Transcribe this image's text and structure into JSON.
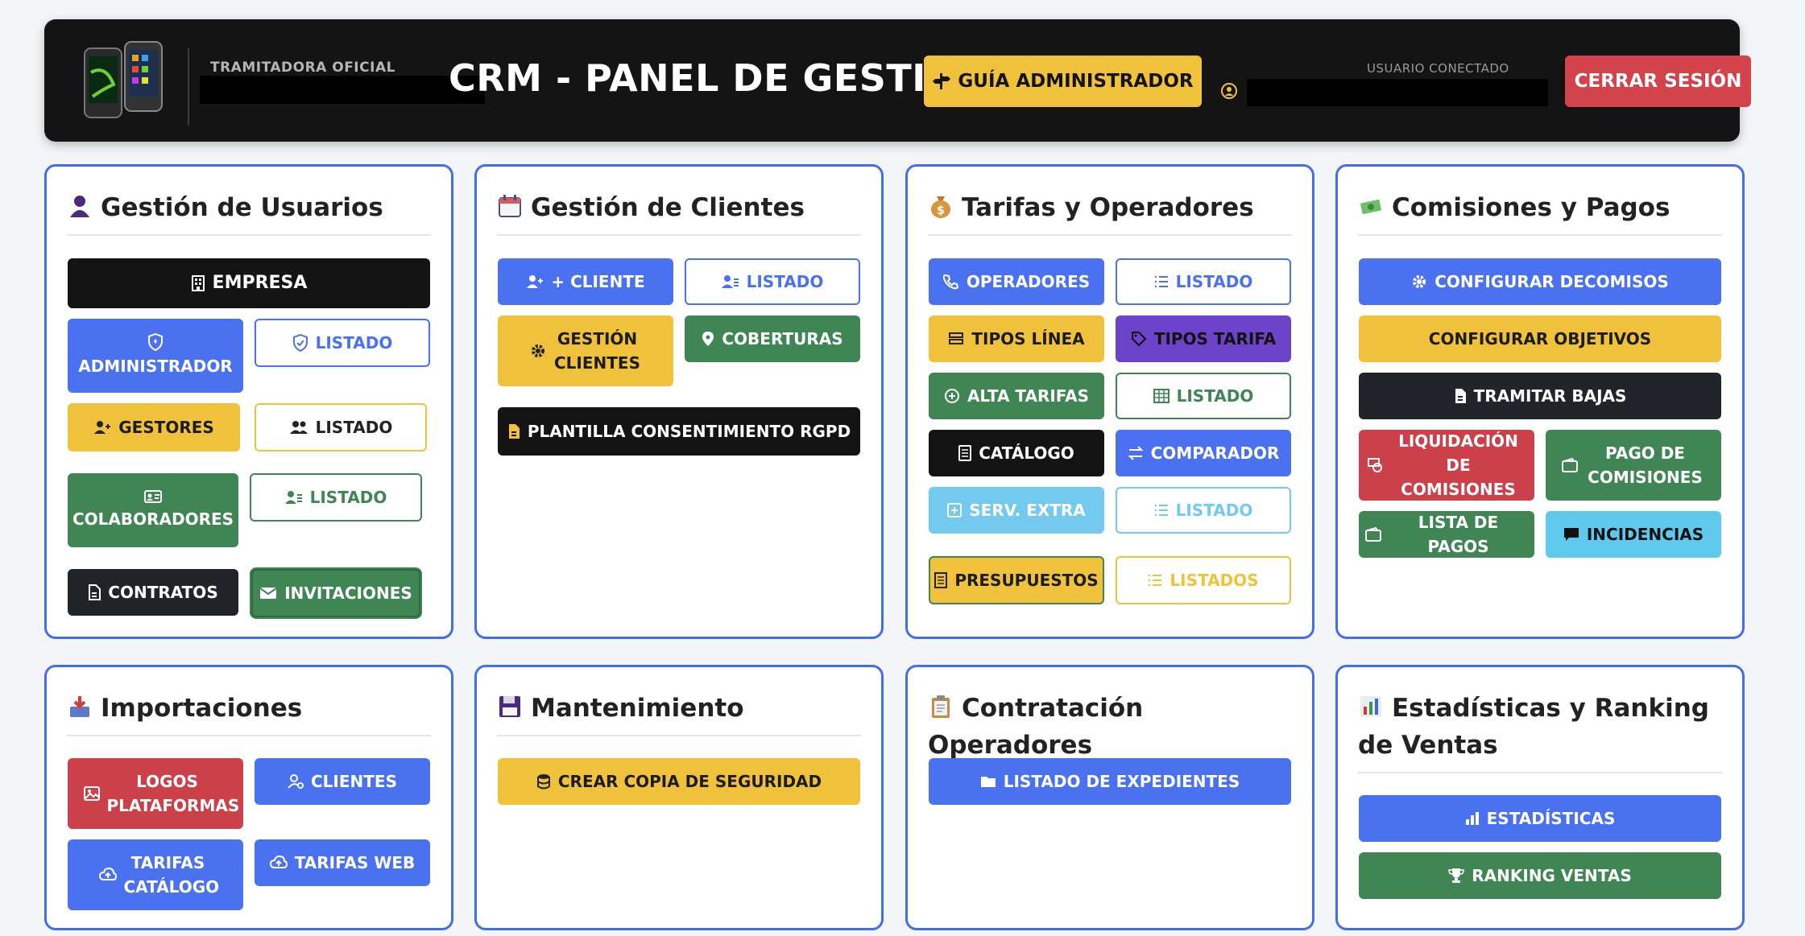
{
  "header": {
    "tramitadora_label": "TRAMITADORA OFICIAL",
    "title": "CRM - PANEL DE GESTIÓN",
    "guide_button": "GUÍA ADMINISTRADOR",
    "user_label": "USUARIO CONECTADO",
    "logout_button": "CERRAR SESIÓN"
  },
  "usuarios": {
    "title": "Gestión de Usuarios",
    "empresa": "EMPRESA",
    "administrador": "ADMINISTRADOR",
    "listado_admin": "LISTADO",
    "gestores": "GESTORES",
    "listado_gestores": "LISTADO",
    "colaboradores": "COLABORADORES",
    "listado_colab": "LISTADO",
    "contratos": "CONTRATOS",
    "invitaciones": "INVITACIONES"
  },
  "clientes": {
    "title": "Gestión de Clientes",
    "cliente": "+ CLIENTE",
    "listado": "LISTADO",
    "gestion_clientes": "GESTIÓN CLIENTES",
    "coberturas": "COBERTURAS",
    "plantilla": "PLANTILLA CONSENTIMIENTO RGPD"
  },
  "tarifas": {
    "title": "Tarifas y Operadores",
    "operadores": "OPERADORES",
    "listado1": "LISTADO",
    "tipos_linea": "TIPOS LÍNEA",
    "tipos_tarifa": "TIPOS TARIFA",
    "alta_tarifas": "ALTA TARIFAS",
    "listado2": "LISTADO",
    "catalogo": "CATÁLOGO",
    "comparador": "COMPARADOR",
    "serv_extra": "SERV. EXTRA",
    "listado3": "LISTADO",
    "presupuestos": "PRESUPUESTOS",
    "listados": "LISTADOS"
  },
  "comisiones": {
    "title": "Comisiones y Pagos",
    "configurar_decomisos": "CONFIGURAR DECOMISOS",
    "configurar_objetivos": "CONFIGURAR OBJETIVOS",
    "tramitar_bajas": "TRAMITAR BAJAS",
    "liquidacion": "LIQUIDACIÓN DE COMISIONES",
    "pago": "PAGO DE COMISIONES",
    "lista_pagos": "LISTA DE PAGOS",
    "incidencias": "INCIDENCIAS"
  },
  "importaciones": {
    "title": "Importaciones",
    "logos": "LOGOS PLATAFORMAS",
    "clientes": "CLIENTES",
    "tarifas_catalogo": "TARIFAS CATÁLOGO",
    "tarifas_web": "TARIFAS WEB"
  },
  "mantenimiento": {
    "title": "Mantenimiento",
    "copia": "CREAR COPIA DE SEGURIDAD"
  },
  "contratacion": {
    "title": "Contratación Operadores",
    "expedientes": "LISTADO DE EXPEDIENTES"
  },
  "estadisticas": {
    "title": "Estadísticas y Ranking de Ventas",
    "estadisticas": "ESTADÍSTICAS",
    "ranking": "RANKING VENTAS"
  },
  "colors": {
    "primary": "#4a72f0",
    "warning": "#f0c23c",
    "success": "#3f8654",
    "danger": "#cc404a",
    "dark": "#212529",
    "info": "#5ec9ec",
    "purple": "#6d43c9"
  }
}
